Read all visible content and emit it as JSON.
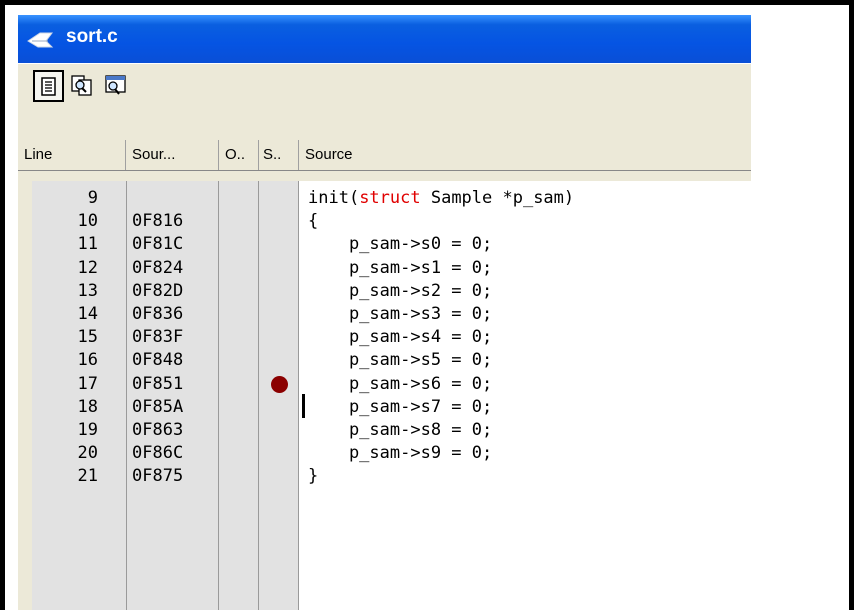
{
  "window": {
    "title": "sort.c"
  },
  "toolbar": {
    "buttons": [
      "source-view-icon",
      "mixed-view-icon",
      "disassembly-view-icon"
    ]
  },
  "columns": [
    "Line",
    "Sour...",
    "O..",
    "S..",
    "Source"
  ],
  "rows": [
    {
      "line": "9",
      "addr": "",
      "pre": "init(",
      "kw": "struct",
      "post": " Sample *p_sam)"
    },
    {
      "line": "10",
      "addr": "0F816",
      "pre": "{",
      "kw": "",
      "post": ""
    },
    {
      "line": "11",
      "addr": "0F81C",
      "pre": "    p_sam->s0 = 0;",
      "kw": "",
      "post": ""
    },
    {
      "line": "12",
      "addr": "0F824",
      "pre": "    p_sam->s1 = 0;",
      "kw": "",
      "post": ""
    },
    {
      "line": "13",
      "addr": "0F82D",
      "pre": "    p_sam->s2 = 0;",
      "kw": "",
      "post": ""
    },
    {
      "line": "14",
      "addr": "0F836",
      "pre": "    p_sam->s3 = 0;",
      "kw": "",
      "post": ""
    },
    {
      "line": "15",
      "addr": "0F83F",
      "pre": "    p_sam->s4 = 0;",
      "kw": "",
      "post": ""
    },
    {
      "line": "16",
      "addr": "0F848",
      "pre": "    p_sam->s5 = 0;",
      "kw": "",
      "post": ""
    },
    {
      "line": "17",
      "addr": "0F851",
      "pre": "    p_sam->s6 = 0;",
      "kw": "",
      "post": ""
    },
    {
      "line": "18",
      "addr": "0F85A",
      "pre": "    p_sam->s7 = 0;",
      "kw": "",
      "post": ""
    },
    {
      "line": "19",
      "addr": "0F863",
      "pre": "    p_sam->s8 = 0;",
      "kw": "",
      "post": ""
    },
    {
      "line": "20",
      "addr": "0F86C",
      "pre": "    p_sam->s9 = 0;",
      "kw": "",
      "post": ""
    },
    {
      "line": "21",
      "addr": "0F875",
      "pre": "}",
      "kw": "",
      "post": ""
    }
  ],
  "breakpoint_line": "17",
  "cursor_line": "18",
  "colors": {
    "titlebar": "#0554e3",
    "keyword": "#e00000",
    "breakpoint": "#8b0000"
  }
}
